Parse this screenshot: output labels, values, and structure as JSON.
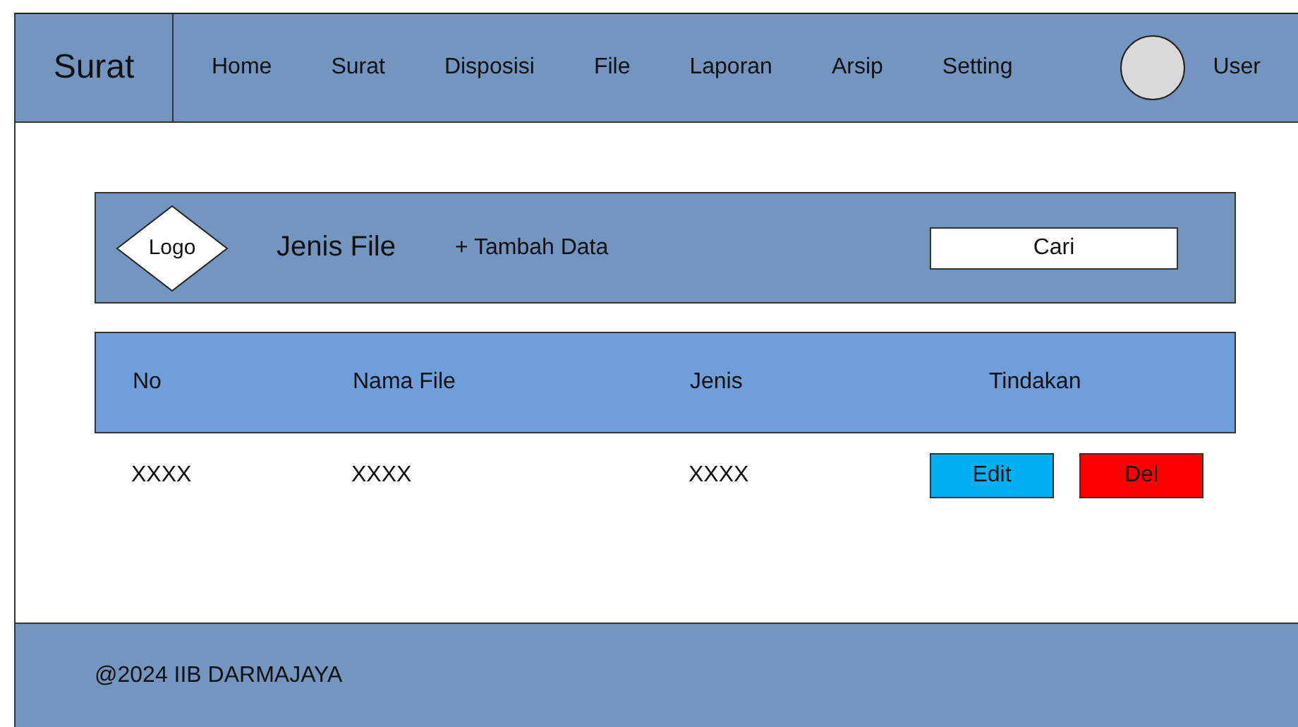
{
  "brand": "Surat",
  "nav": [
    "Home",
    "Surat",
    "Disposisi",
    "File",
    "Laporan",
    "Arsip",
    "Setting"
  ],
  "user": {
    "label": "User"
  },
  "toolbar": {
    "logo": "Logo",
    "title": "Jenis File",
    "add_button": "+ Tambah Data",
    "search": {
      "placeholder": "Cari"
    }
  },
  "table": {
    "columns": [
      "No",
      "Nama File",
      "Jenis",
      "Tindakan"
    ],
    "rows": [
      {
        "cells": [
          "XXXX",
          "XXXX",
          "XXXX"
        ],
        "actions": [
          {
            "label": "Edit",
            "kind": "edit"
          },
          {
            "label": "Del",
            "kind": "delete"
          }
        ]
      }
    ]
  },
  "footer": "@2024 IIB DARMAJAYA"
}
